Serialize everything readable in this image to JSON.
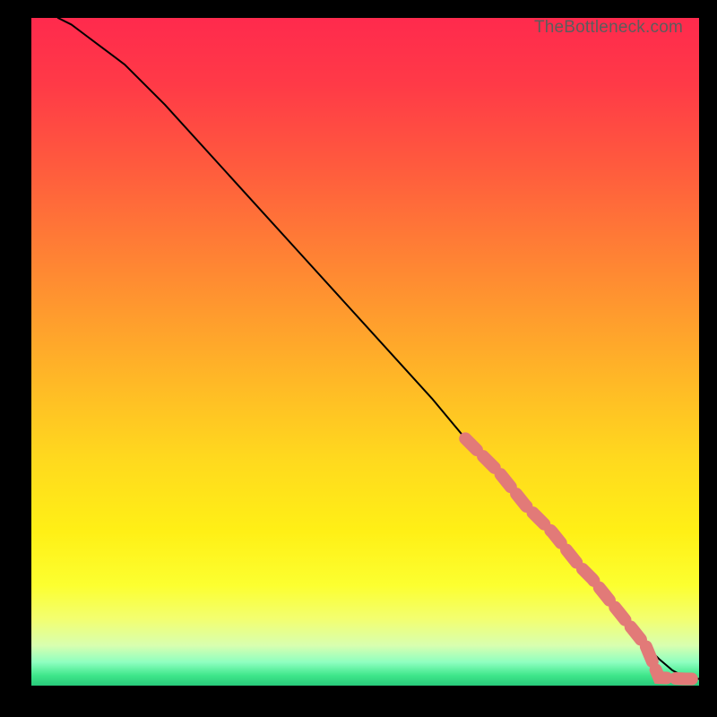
{
  "watermark": "TheBottleneck.com",
  "chart_data": {
    "type": "line",
    "title": "",
    "xlabel": "",
    "ylabel": "",
    "xlim": [
      0,
      100
    ],
    "ylim": [
      0,
      100
    ],
    "series": [
      {
        "name": "curve",
        "style": "solid-black",
        "x": [
          4,
          6,
          8,
          10,
          14,
          20,
          30,
          40,
          50,
          60,
          65,
          70,
          75,
          80,
          83,
          86,
          88,
          90,
          92,
          94,
          96,
          98,
          100
        ],
        "y": [
          100,
          99,
          97.5,
          96,
          93,
          87,
          76,
          65,
          54,
          43,
          37,
          32,
          26,
          20.5,
          17,
          13.5,
          11,
          8.5,
          6,
          4,
          2.3,
          1.2,
          1.0
        ]
      },
      {
        "name": "highlight-dots",
        "style": "dashed-salmon-thick",
        "x": [
          65,
          68,
          70,
          72,
          74,
          76,
          78,
          80,
          82,
          84,
          86,
          88,
          90,
          92,
          94,
          96,
          98,
          100
        ],
        "y": [
          37,
          34,
          32,
          29.5,
          27,
          25,
          23,
          20.5,
          18,
          16,
          13.5,
          11,
          8.5,
          6,
          1.2,
          1.1,
          1.0,
          1.0
        ]
      }
    ],
    "colors": {
      "gradient_top": "#ff2a4d",
      "gradient_bottom": "#28c97a",
      "line": "#000000",
      "dots": "#e27a78"
    }
  }
}
